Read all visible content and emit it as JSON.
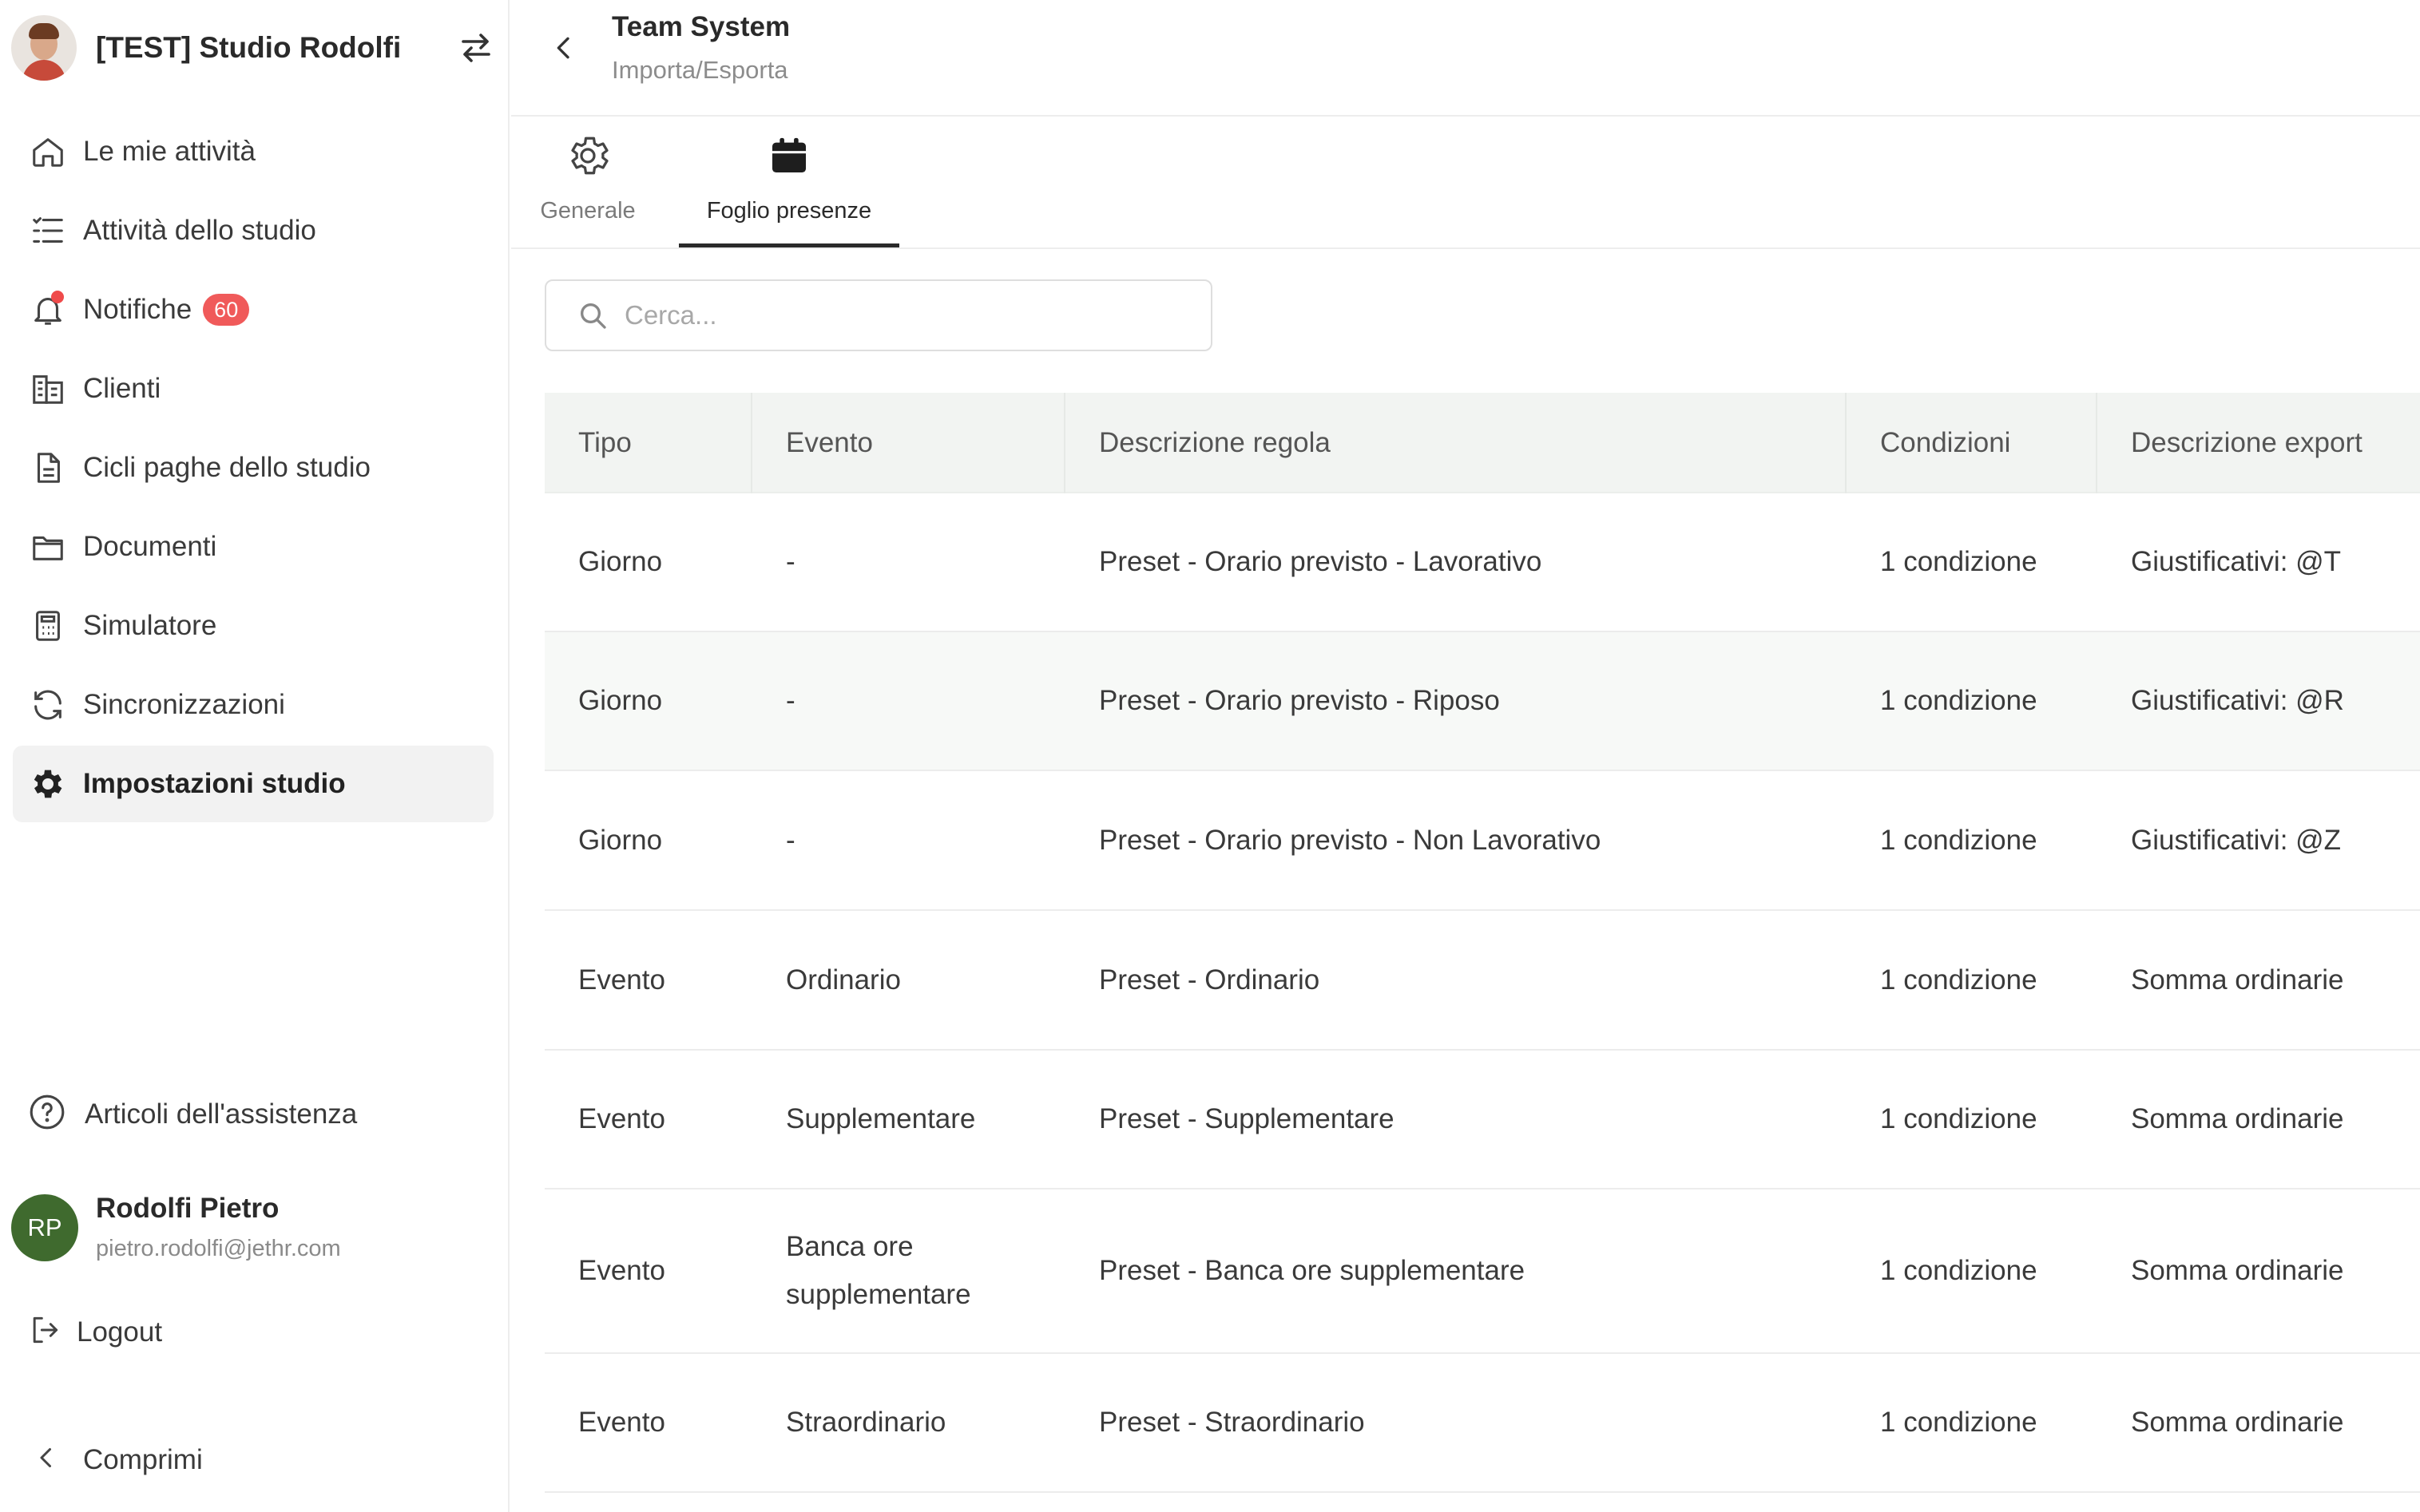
{
  "sidebar": {
    "org_name": "[TEST] Studio Rodolfi",
    "items": [
      {
        "label": "Le mie attività",
        "icon": "home-icon"
      },
      {
        "label": "Attività dello studio",
        "icon": "list-icon"
      },
      {
        "label": "Notifiche",
        "icon": "bell-icon",
        "badge": "60"
      },
      {
        "label": "Clienti",
        "icon": "building-icon"
      },
      {
        "label": "Cicli paghe dello studio",
        "icon": "document-icon"
      },
      {
        "label": "Documenti",
        "icon": "folder-icon"
      },
      {
        "label": "Simulatore",
        "icon": "calculator-icon"
      },
      {
        "label": "Sincronizzazioni",
        "icon": "sync-icon"
      },
      {
        "label": "Impostazioni studio",
        "icon": "gear-icon",
        "active": true
      }
    ],
    "help_label": "Articoli dell'assistenza",
    "user": {
      "initials": "RP",
      "name": "Rodolfi Pietro",
      "email": "pietro.rodolfi@jethr.com"
    },
    "logout_label": "Logout",
    "collapse_label": "Comprimi"
  },
  "header": {
    "title": "Team System",
    "subtitle": "Importa/Esporta"
  },
  "tabs": [
    {
      "label": "Generale",
      "icon": "gear-icon"
    },
    {
      "label": "Foglio presenze",
      "icon": "calendar-icon",
      "active": true
    }
  ],
  "search": {
    "placeholder": "Cerca..."
  },
  "table": {
    "columns": [
      "Tipo",
      "Evento",
      "Descrizione regola",
      "Condizioni",
      "Descrizione export"
    ],
    "rows": [
      [
        "Giorno",
        "-",
        "Preset - Orario previsto - Lavorativo",
        "1 condizione",
        "Giustificativi: @T"
      ],
      [
        "Giorno",
        "-",
        "Preset - Orario previsto - Riposo",
        "1 condizione",
        "Giustificativi: @R"
      ],
      [
        "Giorno",
        "-",
        "Preset - Orario previsto - Non Lavorativo",
        "1 condizione",
        "Giustificativi: @Z"
      ],
      [
        "Evento",
        "Ordinario",
        "Preset - Ordinario",
        "1 condizione",
        "Somma ordinarie"
      ],
      [
        "Evento",
        "Supplementare",
        "Preset - Supplementare",
        "1 condizione",
        "Somma ordinarie"
      ],
      [
        "Evento",
        "Banca ore supplementare",
        "Preset - Banca ore supplementare",
        "1 condizione",
        "Somma ordinarie"
      ],
      [
        "Evento",
        "Straordinario",
        "Preset - Straordinario",
        "1 condizione",
        "Somma ordinarie"
      ]
    ]
  },
  "colors": {
    "accent": "#2a2a2a",
    "badge": "#f05a5a",
    "avatar": "#3f6a2e",
    "header_bg": "#f2f4f2"
  }
}
